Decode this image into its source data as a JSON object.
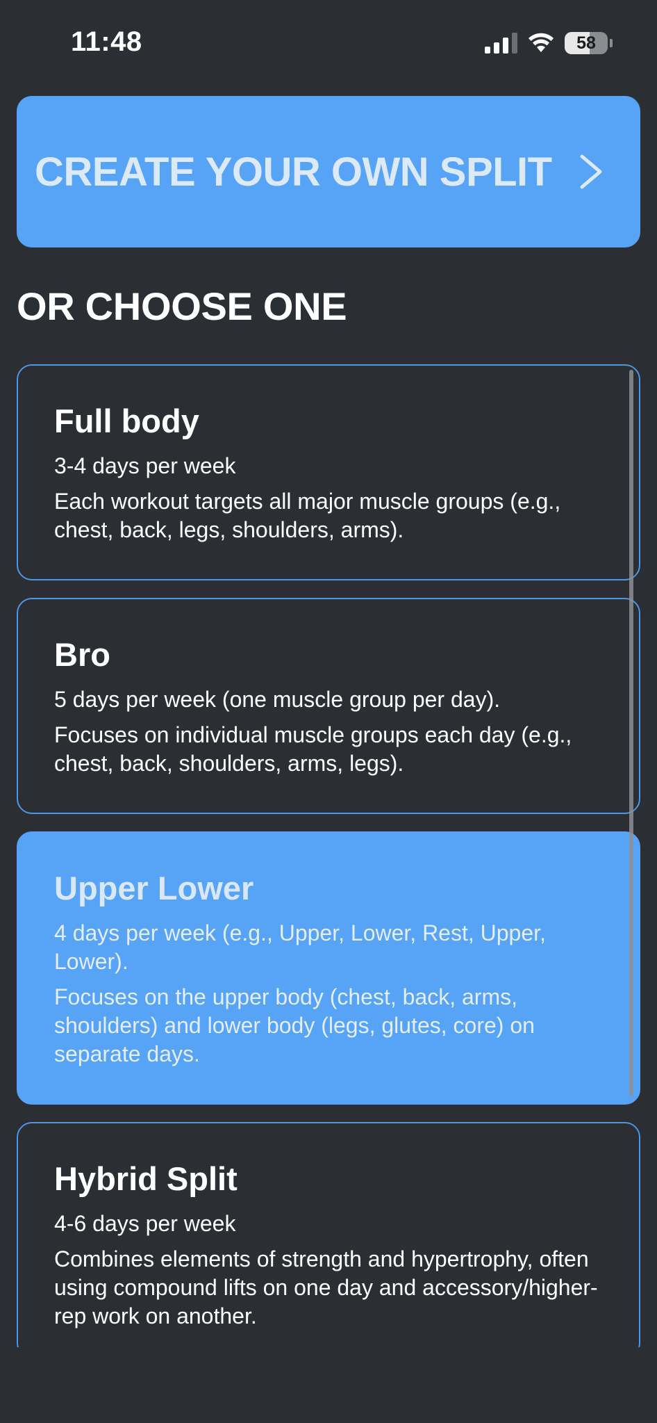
{
  "status_bar": {
    "time": "11:48",
    "battery": "58"
  },
  "create_button": {
    "label": "CREATE YOUR OWN SPLIT"
  },
  "section": {
    "heading": "OR CHOOSE ONE"
  },
  "splits": [
    {
      "title": "Full body",
      "days": "3-4 days per week",
      "description": "Each workout targets all major muscle groups (e.g., chest, back, legs, shoulders, arms).",
      "selected": false
    },
    {
      "title": "Bro",
      "days": "5 days per week (one muscle group per day).",
      "description": "Focuses on individual muscle groups each day (e.g., chest, back, shoulders, arms, legs).",
      "selected": false
    },
    {
      "title": "Upper Lower",
      "days": "4 days per week (e.g., Upper, Lower, Rest, Upper, Lower).",
      "description": "Focuses on the upper body (chest, back, arms, shoulders) and lower body (legs, glutes, core) on separate days.",
      "selected": true
    },
    {
      "title": "Hybrid Split",
      "days": "4-6 days per week",
      "description": "Combines elements of strength and hypertrophy, often using compound lifts on one day and accessory/higher-rep work on another.",
      "selected": false
    }
  ],
  "colors": {
    "background": "#2b2e33",
    "accent": "#57a3f5",
    "card_border": "#4f95e6"
  }
}
